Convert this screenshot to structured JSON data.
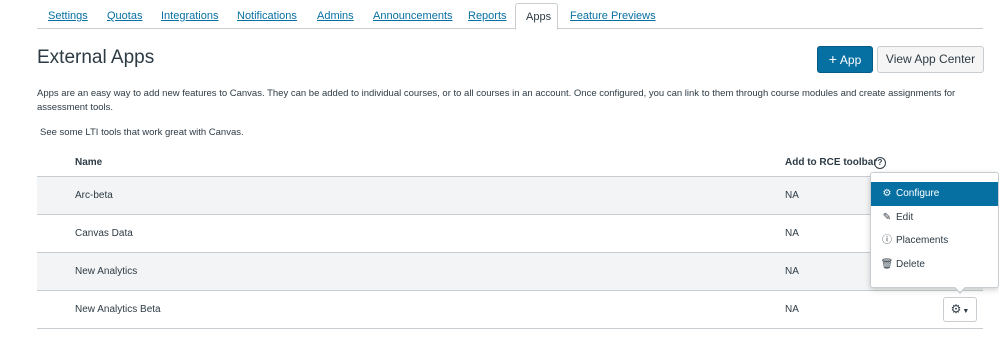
{
  "tabs": [
    "Settings",
    "Quotas",
    "Integrations",
    "Notifications",
    "Admins",
    "Announcements",
    "Reports",
    "Apps",
    "Feature Previews"
  ],
  "active_tab": "Apps",
  "header": {
    "title": "External Apps",
    "add_plus": "+",
    "add_label": "App",
    "view_center_label": "View App Center"
  },
  "description": "Apps are an easy way to add new features to Canvas. They can be added to individual courses, or to all courses in an account. Once configured, you can link to them through course modules and create assignments for assessment tools.",
  "lti_link_text": "See some LTI tools that work great with Canvas.",
  "table": {
    "columns": [
      "Name",
      "Add to RCE toolbar"
    ],
    "help_glyph": "?",
    "rows": [
      {
        "name": "Arc-beta",
        "rce": "NA"
      },
      {
        "name": "Canvas Data",
        "rce": "NA"
      },
      {
        "name": "New Analytics",
        "rce": "NA"
      },
      {
        "name": "New Analytics Beta",
        "rce": "NA"
      }
    ]
  },
  "menu": {
    "items": [
      {
        "label": "Configure",
        "icon": "gear-icon",
        "glyph": "⚙"
      },
      {
        "label": "Edit",
        "icon": "pencil-icon",
        "glyph": "✎"
      },
      {
        "label": "Placements",
        "icon": "info-icon",
        "glyph": "ⓘ"
      },
      {
        "label": "Delete",
        "icon": "trash-icon",
        "glyph": "🗑"
      }
    ],
    "selected": "Configure"
  },
  "gear_button": {
    "glyph": "⚙",
    "caret": "▼"
  },
  "colors": {
    "accent": "#0770a3",
    "text": "#2d3b45",
    "border": "#c7cdd1",
    "row_alt": "#f3f4f5"
  }
}
